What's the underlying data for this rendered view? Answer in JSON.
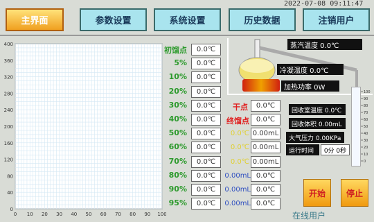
{
  "nav": {
    "main": "主界面",
    "params": "参数设置",
    "system": "系统设置",
    "history": "历史数据",
    "logout": "注销用户"
  },
  "timestamp": "2022-07-08 09:11:47",
  "chart_data": {
    "type": "line",
    "x_ticks": [
      "0",
      "10",
      "20",
      "30",
      "40",
      "50",
      "60",
      "70",
      "80",
      "90",
      "100"
    ],
    "y_ticks": [
      "0",
      "40",
      "80",
      "120",
      "160",
      "200",
      "240",
      "280",
      "320",
      "360",
      "400"
    ],
    "xlim": [
      0,
      100
    ],
    "ylim": [
      0,
      400
    ],
    "grid": true,
    "series": []
  },
  "readings": [
    {
      "label": "初馏点",
      "value": "0.0℃"
    },
    {
      "label": "5%",
      "value": "0.0℃"
    },
    {
      "label": "10%",
      "value": "0.0℃"
    },
    {
      "label": "20%",
      "value": "0.0℃"
    },
    {
      "label": "30%",
      "value": "0.0℃"
    },
    {
      "label": "40%",
      "value": "0.0℃"
    },
    {
      "label": "50%",
      "value": "0.0℃"
    },
    {
      "label": "60%",
      "value": "0.0℃"
    },
    {
      "label": "70%",
      "value": "0.0℃"
    },
    {
      "label": "80%",
      "value": "0.0℃"
    },
    {
      "label": "90%",
      "value": "0.0℃"
    },
    {
      "label": "95%",
      "value": "0.0℃"
    }
  ],
  "dry_point": {
    "label": "干点",
    "value": "0.0℃"
  },
  "end_point": {
    "label": "终馏点",
    "value": "0.0℃"
  },
  "extra_rows": [
    {
      "a": "0.0℃",
      "b": "0.00mL"
    },
    {
      "a": "0.0℃",
      "b": "0.00mL"
    },
    {
      "a": "0.0℃",
      "b": "0.00mL"
    },
    {
      "a": "0.00mL",
      "b": "0.0℃"
    },
    {
      "a": "0.00mL",
      "b": "0.0℃"
    },
    {
      "a": "0.00mL",
      "b": "0.0℃"
    }
  ],
  "apparatus": {
    "vapor_temp": "蒸汽温度 0.0℃",
    "cond_temp": "冷凝温度 0.0℃",
    "heat_power": "加热功率 0W",
    "recv_temp": "回收室温度 0.0℃",
    "recv_vol": "回收体积 0.00mL",
    "pressure": "大气压力 0.00KPa",
    "runtime": "运行时间",
    "runtime_val": "0分 0秒"
  },
  "buttons": {
    "start": "开始",
    "stop": "停止"
  },
  "online_user": "在线用户",
  "cylinder_ticks": [
    "100",
    "90",
    "80",
    "70",
    "60",
    "50",
    "40",
    "30",
    "20",
    "10",
    "0"
  ]
}
